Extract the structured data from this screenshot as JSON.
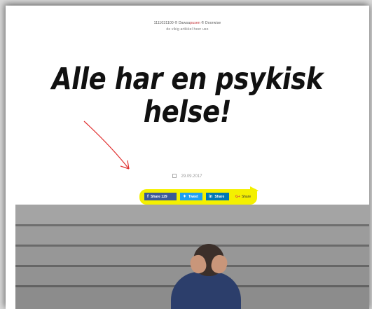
{
  "header": {
    "line1_prefix": "1111031100 ®  Dawsa",
    "line1_accent": "pusen",
    "line1_suffix": " ®  Doorwise",
    "line2": "de vikig artikkel heer uso"
  },
  "article": {
    "title": "Alle har en psykisk helse!",
    "date": "29.09.2017"
  },
  "share": {
    "facebook_label": "Share 129",
    "twitter_label": "Tweet",
    "linkedin_label": "Share",
    "googleplus_label": "Share",
    "googleplus_prefix": "G+"
  },
  "colors": {
    "highlight": "#f4f000",
    "annotation_arrow": "#e03030",
    "facebook": "#3b5998",
    "twitter": "#1da1f2",
    "linkedin": "#0077b5"
  },
  "icons": {
    "calendar": "calendar-icon",
    "facebook": "facebook-icon",
    "twitter": "twitter-icon",
    "linkedin": "linkedin-icon"
  }
}
